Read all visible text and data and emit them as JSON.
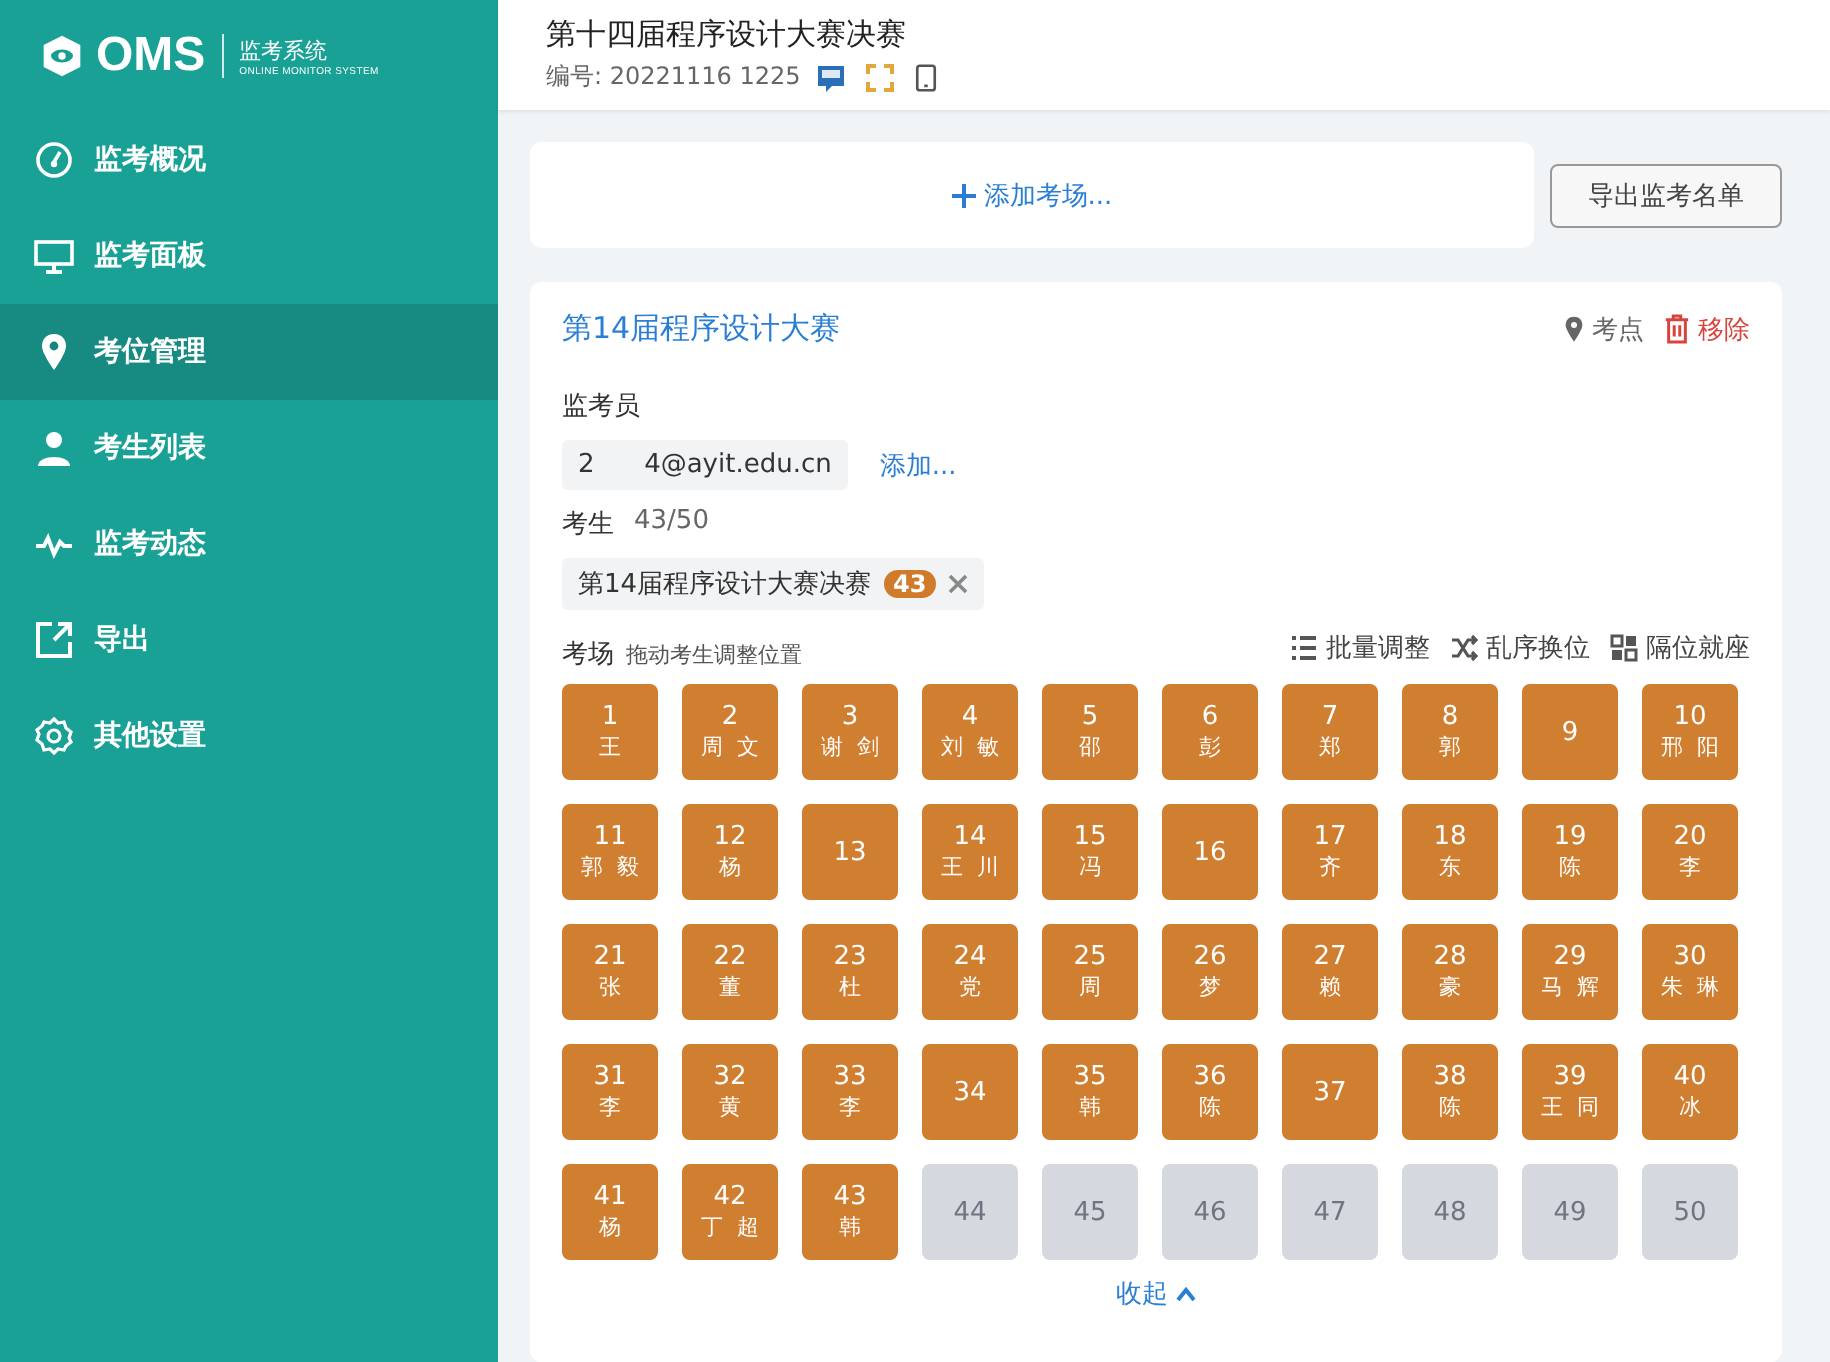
{
  "logo": {
    "name": "OMS",
    "title": "监考系统",
    "subtitle": "ONLINE MONITOR SYSTEM"
  },
  "sidebar": {
    "items": [
      {
        "label": "监考概况",
        "selected": false
      },
      {
        "label": "监考面板",
        "selected": false
      },
      {
        "label": "考位管理",
        "selected": true
      },
      {
        "label": "考生列表",
        "selected": false
      },
      {
        "label": "监考动态",
        "selected": false
      },
      {
        "label": "导出",
        "selected": false
      },
      {
        "label": "其他设置",
        "selected": false
      }
    ]
  },
  "header": {
    "title": "第十四届程序设计大赛决赛",
    "code": "编号: 20221116 1225"
  },
  "add_room": "添加考场...",
  "export_button": "导出监考名单",
  "room": {
    "title": "第14届程序设计大赛",
    "location": "考点",
    "remove": "移除",
    "proctor_label": "监考员",
    "proctor": "2      4@ayit.edu.cn",
    "add_proctor": "添加...",
    "students_label": "考生",
    "students_count": "43/50",
    "group": {
      "label": "第14届程序设计大赛决赛",
      "count": "43"
    },
    "seats_label": "考场",
    "seats_hint": "拖动考生调整位置",
    "actions": [
      {
        "label": "批量调整"
      },
      {
        "label": "乱序换位"
      },
      {
        "label": "隔位就座"
      }
    ],
    "seats": [
      {
        "number": "1",
        "name": "王",
        "occupied": true
      },
      {
        "number": "2",
        "name": "周  文",
        "occupied": true
      },
      {
        "number": "3",
        "name": "谢  剑",
        "occupied": true
      },
      {
        "number": "4",
        "name": "刘  敏",
        "occupied": true
      },
      {
        "number": "5",
        "name": "邵",
        "occupied": true
      },
      {
        "number": "6",
        "name": "彭",
        "occupied": true
      },
      {
        "number": "7",
        "name": "郑",
        "occupied": true
      },
      {
        "number": "8",
        "name": "郭",
        "occupied": true
      },
      {
        "number": "9",
        "occupied": true
      },
      {
        "number": "10",
        "name": "邢  阳",
        "occupied": true
      },
      {
        "number": "11",
        "name": "郭  毅",
        "occupied": true
      },
      {
        "number": "12",
        "name": "杨",
        "occupied": true
      },
      {
        "number": "13",
        "occupied": true
      },
      {
        "number": "14",
        "name": "王  川",
        "occupied": true
      },
      {
        "number": "15",
        "name": "冯",
        "occupied": true
      },
      {
        "number": "16",
        "occupied": true
      },
      {
        "number": "17",
        "name": "齐",
        "occupied": true
      },
      {
        "number": "18",
        "name": "东",
        "occupied": true
      },
      {
        "number": "19",
        "name": "陈",
        "occupied": true
      },
      {
        "number": "20",
        "name": "李",
        "occupied": true
      },
      {
        "number": "21",
        "name": "张",
        "occupied": true
      },
      {
        "number": "22",
        "name": "董",
        "occupied": true
      },
      {
        "number": "23",
        "name": "杜",
        "occupied": true
      },
      {
        "number": "24",
        "name": "党",
        "occupied": true
      },
      {
        "number": "25",
        "name": "周",
        "occupied": true
      },
      {
        "number": "26",
        "name": "梦",
        "occupied": true
      },
      {
        "number": "27",
        "name": "赖",
        "occupied": true
      },
      {
        "number": "28",
        "name": "豪",
        "occupied": true
      },
      {
        "number": "29",
        "name": "马  辉",
        "occupied": true
      },
      {
        "number": "30",
        "name": "朱  琳",
        "occupied": true
      },
      {
        "number": "31",
        "name": "李",
        "occupied": true
      },
      {
        "number": "32",
        "name": "黄",
        "occupied": true
      },
      {
        "number": "33",
        "name": "李",
        "occupied": true
      },
      {
        "number": "34",
        "occupied": true
      },
      {
        "number": "35",
        "name": "韩",
        "occupied": true
      },
      {
        "number": "36",
        "name": "陈",
        "occupied": true
      },
      {
        "number": "37",
        "occupied": true
      },
      {
        "number": "38",
        "name": "陈",
        "occupied": true
      },
      {
        "number": "39",
        "name": "王  同",
        "occupied": true
      },
      {
        "number": "40",
        "name": "冰",
        "occupied": true
      },
      {
        "number": "41",
        "name": "杨",
        "occupied": true
      },
      {
        "number": "42",
        "name": "丁  超",
        "occupied": true
      },
      {
        "number": "43",
        "name": "韩",
        "occupied": true
      },
      {
        "number": "44",
        "occupied": false
      },
      {
        "number": "45",
        "occupied": false
      },
      {
        "number": "46",
        "occupied": false
      },
      {
        "number": "47",
        "occupied": false
      },
      {
        "number": "48",
        "occupied": false
      },
      {
        "number": "49",
        "occupied": false
      },
      {
        "number": "50",
        "occupied": false
      }
    ],
    "collapse": "收起"
  }
}
